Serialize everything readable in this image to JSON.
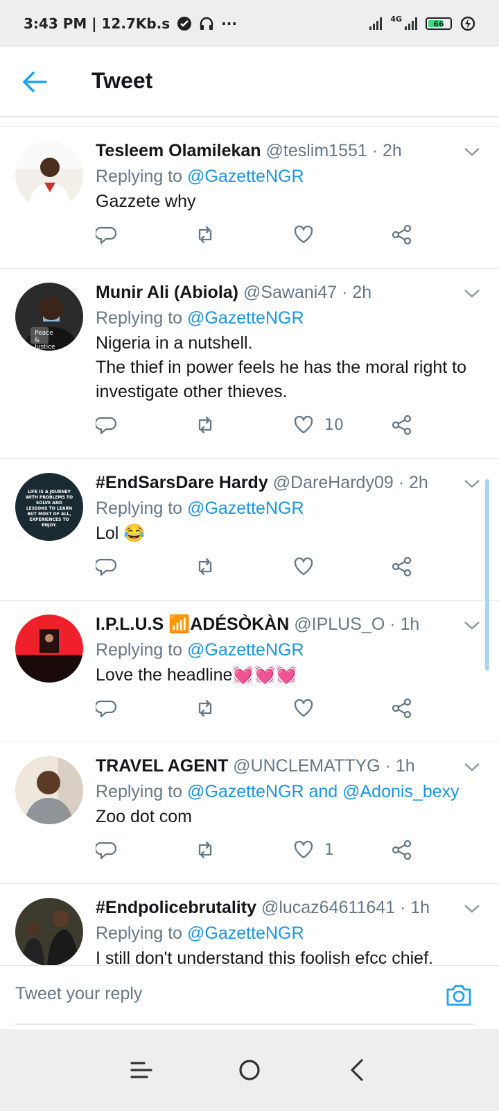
{
  "status_bar": {
    "time": "3:43 PM | 12.7Kb.s",
    "more": "···",
    "network": "4G",
    "battery": "66"
  },
  "header": {
    "title": "Tweet"
  },
  "tweets": [
    {
      "name": "Tesleem Olamilekan",
      "handle": "@teslim1551 · 2h",
      "replying": "Replying to",
      "mentions": "@GazetteNGR",
      "text": "Gazzete why",
      "likes": ""
    },
    {
      "name": "Munir Ali (Abiola)",
      "handle": "@Sawani47 · 2h",
      "replying": "Replying to",
      "mentions": "@GazetteNGR",
      "text": "Nigeria in a nutshell.\nThe thief in power feels he has the moral right to investigate other thieves.",
      "likes": "10"
    },
    {
      "name": "#EndSarsDare Hardy",
      "handle": "@DareHardy09 · 2h",
      "replying": "Replying to",
      "mentions": "@GazetteNGR",
      "text": "Lol 😂",
      "likes": ""
    },
    {
      "name": "I.P.L.U.S 📶ADÉSÒKÀN",
      "handle": "@IPLUS_O · 1h",
      "replying": "Replying to",
      "mentions": "@GazetteNGR",
      "text": "Love the headline💓💓💓",
      "likes": ""
    },
    {
      "name": "TRAVEL AGENT",
      "handle": "@UNCLEMATTYG · 1h",
      "replying": "Replying to",
      "mentions": "@GazetteNGR and @Adonis_bexy",
      "text": "Zoo dot com",
      "likes": "1"
    },
    {
      "name": "#Endpolicebrutality",
      "handle": "@lucaz64611641 · 1h",
      "replying": "Replying to",
      "mentions": "@GazetteNGR",
      "text": "I still don't understand this foolish efcc chief.\nPublic Office holders who are constitutionally",
      "likes": ""
    }
  ],
  "avatars": {
    "t2_caption": "Peace & Justice",
    "t3_quote": "LIFE IS A JOURNEY WITH PROBLEMS TO SOLVE AND LESSONS TO LEARN BUT MOST OF ALL, EXPERIENCES TO ENJOY."
  },
  "composer": {
    "placeholder": "Tweet your reply"
  },
  "colors": {
    "accent": "#1da1f2",
    "mention": "#1b95e0",
    "secondary_text": "#657786",
    "divider": "#e1e8ed"
  },
  "icons": [
    "back-arrow-icon",
    "chevron-down-icon",
    "reply-icon",
    "retweet-icon",
    "like-icon",
    "share-icon",
    "camera-icon",
    "menu-icon",
    "home-icon",
    "back-icon"
  ]
}
